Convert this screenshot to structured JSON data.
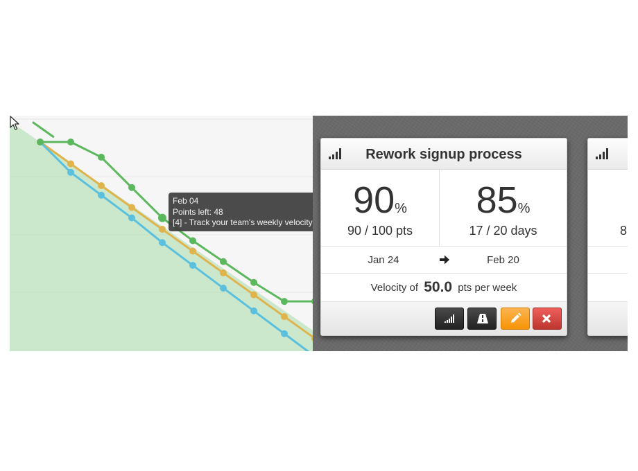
{
  "tooltip": {
    "date": "Feb 04",
    "points_left": "Points left: 48",
    "story": "[4] - Track your team's weekly velocity"
  },
  "chart_data": {
    "type": "line",
    "title": "",
    "xlabel": "",
    "ylabel": "",
    "grid": true,
    "series": [
      {
        "color": "#e0b44c",
        "x": [
          0,
          1,
          2,
          3,
          4,
          5,
          6,
          7,
          8,
          9
        ],
        "y": [
          100,
          88.5,
          77,
          65.5,
          54,
          42.5,
          31,
          19.5,
          8,
          -3.5
        ]
      },
      {
        "color": "#5bc0de",
        "x": [
          0,
          1,
          2,
          3,
          4,
          5,
          6,
          7,
          8,
          9
        ],
        "y": [
          100,
          84,
          72,
          60,
          47,
          35,
          23,
          11,
          -1,
          -13
        ]
      },
      {
        "color": "#5cb85c",
        "x": [
          0,
          1,
          2,
          3,
          4,
          5,
          6,
          7,
          8,
          9
        ],
        "y": [
          100,
          100,
          92,
          76,
          60,
          48,
          37,
          26,
          16,
          16
        ]
      },
      {
        "color": "#5cb85c",
        "x": [
          -0.25,
          0.45
        ],
        "y": [
          110.5,
          102.5
        ]
      }
    ],
    "area": {
      "color": "#a8dcaa",
      "x": [
        0,
        9
      ],
      "y": [
        100,
        0
      ]
    },
    "highlight_index": 4
  },
  "cards": [
    {
      "title": "Rework signup process",
      "percent_points": "90",
      "percent_points_unit": "%",
      "points_text": "90 / 100 pts",
      "percent_days": "85",
      "percent_days_unit": "%",
      "days_text": "17 / 20 days",
      "start": "Jan 24",
      "end": "Feb 20",
      "velocity_prefix": "Velocity of",
      "velocity_value": "50.0",
      "velocity_suffix": "pts per week",
      "icons": {
        "signal": "signal-bars-icon",
        "chart": "signal-bars-icon",
        "road": "road-icon",
        "edit": "pencil-icon",
        "delete": "close-icon",
        "arrow": "arrow-right-icon"
      },
      "button_colors": {
        "dark": "#333333",
        "edit": "#f89406",
        "delete": "#da4f49"
      }
    },
    {
      "points_text_partial": "8",
      "percent_partial": "("
    }
  ]
}
